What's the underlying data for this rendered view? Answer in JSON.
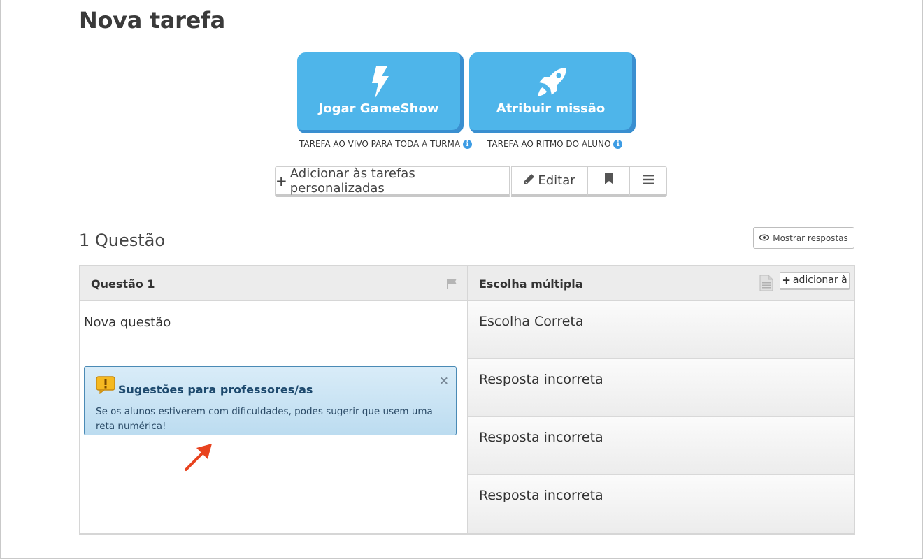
{
  "page": {
    "title": "Nova tarefa"
  },
  "actions": {
    "gameshow": {
      "label": "Jogar GameShow",
      "caption": "TAREFA AO VIVO PARA TODA A TURMA",
      "icon": "lightning-icon"
    },
    "mission": {
      "label": "Atribuir missão",
      "caption": "TAREFA AO RITMO DO ALUNO",
      "icon": "rocket-icon"
    }
  },
  "toolbar": {
    "add_label": "Adicionar às tarefas personalizadas",
    "edit_label": "Editar"
  },
  "questions": {
    "count_label": "1 Questão",
    "show_answers_label": "Mostrar respostas"
  },
  "question": {
    "header": "Questão 1",
    "type": "Escolha múltipla",
    "add_to_label": "adicionar à",
    "text": "Nova questão",
    "answers": [
      "Escolha Correta",
      "Resposta incorreta",
      "Resposta incorreta",
      "Resposta incorreta"
    ]
  },
  "tips": {
    "title": "Sugestões para professores/as",
    "body": "Se os alunos estiverem com dificuldades, podes sugerir que usem uma reta numérica!"
  },
  "colors": {
    "primary_blue": "#4eb5ea",
    "primary_blue_shadow": "#3a8fd0",
    "tips_bg": "#cfe6f5",
    "arrow": "#e8431f"
  }
}
